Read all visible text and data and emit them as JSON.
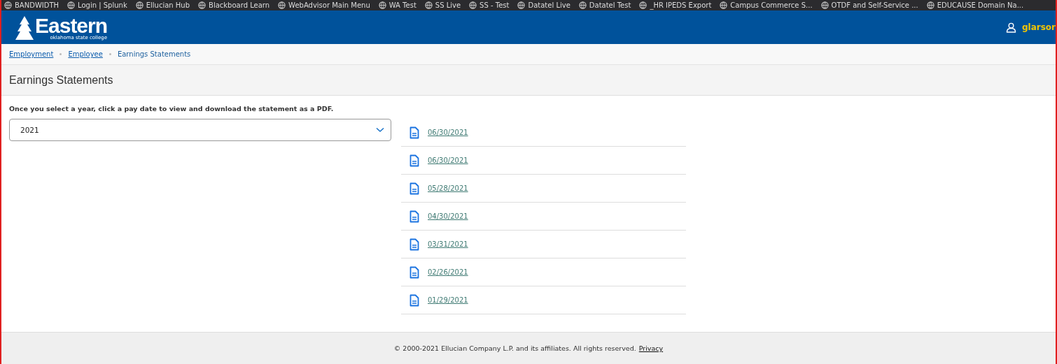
{
  "bookmarks": [
    {
      "label": "BANDWIDTH"
    },
    {
      "label": "Login | Splunk"
    },
    {
      "label": "Ellucian Hub"
    },
    {
      "label": "Blackboard Learn"
    },
    {
      "label": "WebAdvisor Main Menu"
    },
    {
      "label": "WA Test"
    },
    {
      "label": "SS Live"
    },
    {
      "label": "SS - Test"
    },
    {
      "label": "Datatel Live"
    },
    {
      "label": "Datatel Test"
    },
    {
      "label": "_HR IPEDS Export"
    },
    {
      "label": "Campus Commerce S..."
    },
    {
      "label": "OTDF and Self-Service ..."
    },
    {
      "label": "EDUCAUSE Domain Na..."
    }
  ],
  "header": {
    "logo_text": "Eastern",
    "logo_subtitle": "oklahoma state college",
    "user": "glarsor"
  },
  "breadcrumb": [
    {
      "label": "Employment",
      "link": true
    },
    {
      "label": "Employee",
      "link": true
    },
    {
      "label": "Earnings Statements",
      "link": false
    }
  ],
  "page_title": "Earnings Statements",
  "instructions": "Once you select a year, click a pay date to view and download the statement as a PDF.",
  "year_select": {
    "value": "2021"
  },
  "statements": [
    "06/30/2021",
    "06/30/2021",
    "05/28/2021",
    "04/30/2021",
    "03/31/2021",
    "02/26/2021",
    "01/29/2021"
  ],
  "footer": {
    "copyright": "© 2000-2021 Ellucian Company L.P. and its affiliates. All rights reserved.",
    "link": "Privacy"
  }
}
